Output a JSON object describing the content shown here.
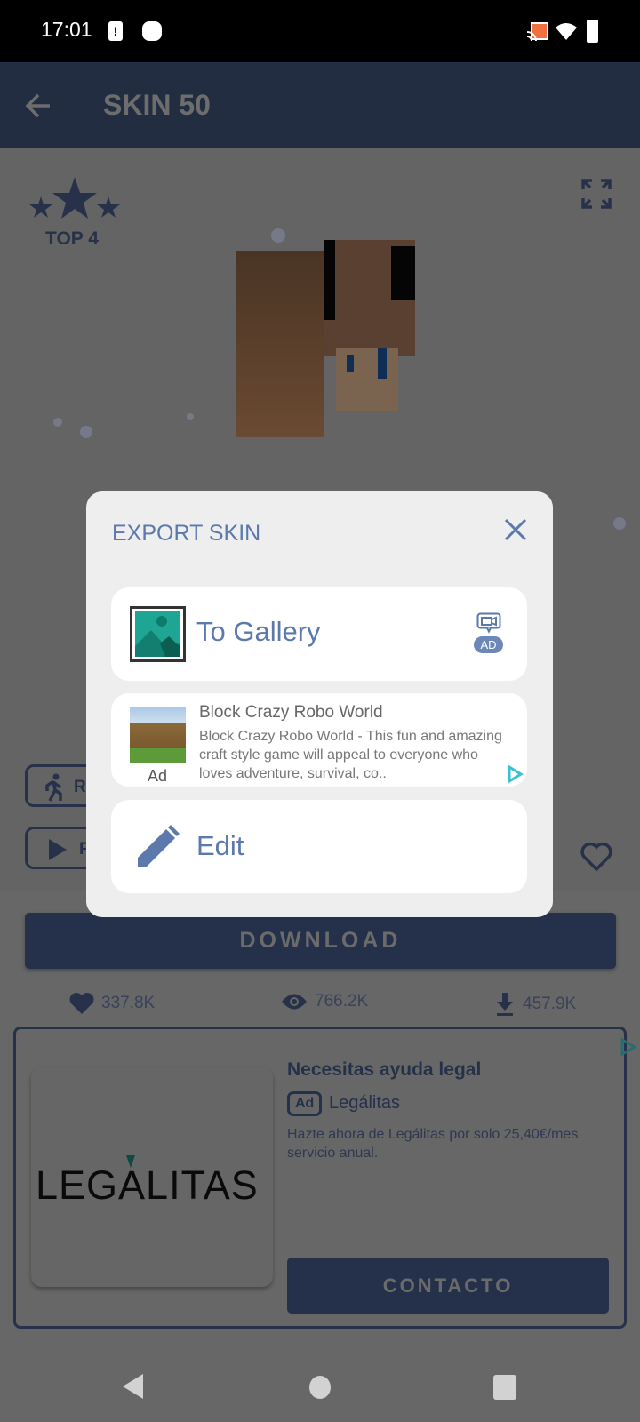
{
  "status_bar": {
    "time": "17:01",
    "icons": [
      "sim-alert-icon",
      "notification-icon",
      "cast-icon",
      "wifi-icon",
      "battery-icon"
    ]
  },
  "app_bar": {
    "title": "SKIN 50",
    "back_icon": "arrow-left-icon"
  },
  "skin_viewer": {
    "rank_label": "TOP 4",
    "expand_icon": "fullscreen-icon",
    "pose_buttons": [
      {
        "icon": "run-icon",
        "label": "R"
      },
      {
        "icon": "play-icon",
        "label": "P"
      }
    ],
    "favorite_icon": "heart-outline-icon"
  },
  "dialog": {
    "title": "EXPORT SKIN",
    "close_icon": "close-icon",
    "to_gallery": {
      "label": "To Gallery",
      "badge": "AD",
      "badge_icon": "video-ad-icon"
    },
    "native_ad": {
      "title": "Block Crazy Robo World",
      "description": "Block Crazy Robo World - This fun and amazing craft style game will appeal to everyone who loves adventure, survival, co..",
      "ad_label": "Ad"
    },
    "edit": {
      "label": "Edit",
      "icon": "pencil-icon"
    }
  },
  "download_button": "DOWNLOAD",
  "stats": {
    "likes": "337.8K",
    "views": "766.2K",
    "downloads": "457.9K"
  },
  "banner_ad": {
    "title": "Necesitas ayuda legal",
    "badge": "Ad",
    "advertiser": "Legálitas",
    "description": "Hazte ahora de Legálitas por solo 25,40€/mes servicio anual.",
    "logo_text": "LEGALITAS",
    "cta": "CONTACTO"
  },
  "colors": {
    "accent": "#5b79ad",
    "primary_dark": "#25314a"
  }
}
